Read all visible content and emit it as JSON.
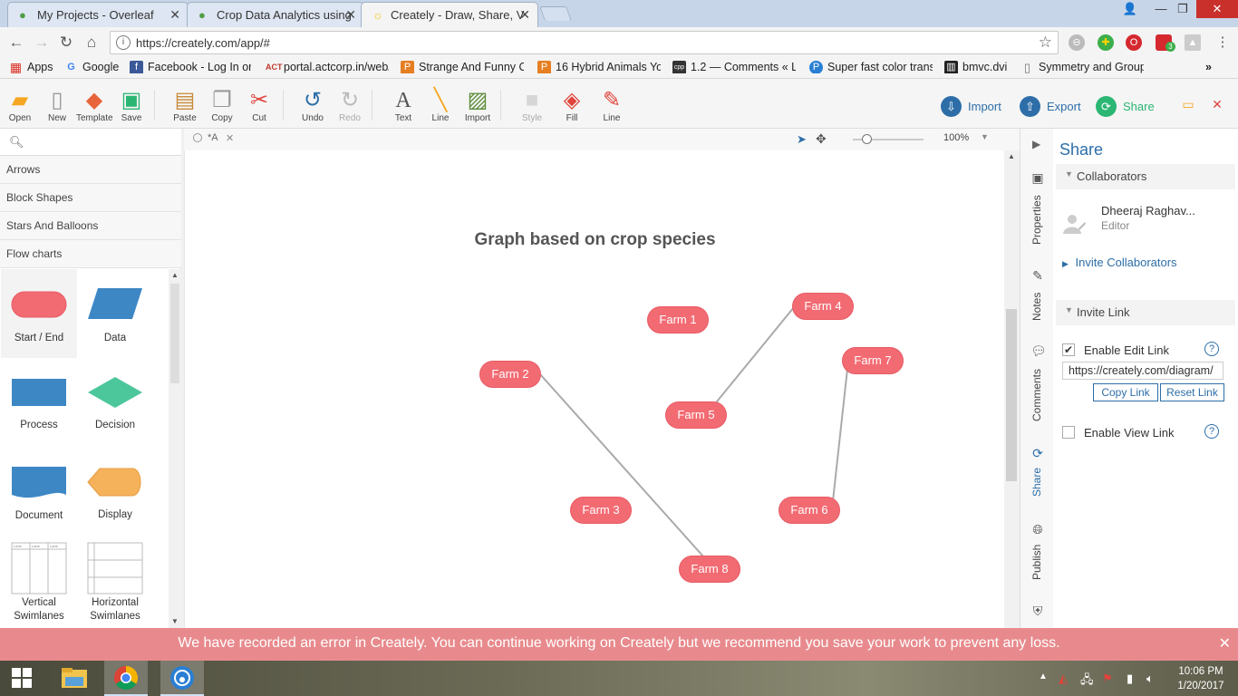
{
  "browser": {
    "tabs": [
      {
        "title": "My Projects - Overleaf",
        "icon": "overleaf-icon",
        "active": false
      },
      {
        "title": "Crop Data Analytics using",
        "icon": "overleaf-icon",
        "active": false
      },
      {
        "title": "Creately - Draw, Share, V",
        "icon": "creately-sun-icon",
        "active": true
      }
    ],
    "url": "https://creately.com/app/#",
    "extension_badge": "3"
  },
  "bookmarks": [
    {
      "label": "Apps",
      "icon": "apps-grid-icon",
      "color": "#d93025"
    },
    {
      "label": "Google",
      "icon": "google-icon",
      "color": "#4285f4"
    },
    {
      "label": "Facebook - Log In or",
      "icon": "facebook-icon",
      "color": "#3b5998"
    },
    {
      "label": "portal.actcorp.in/web/",
      "icon": "act-icon",
      "color": "#c0392b"
    },
    {
      "label": "Strange And Funny C",
      "icon": "p-icon",
      "color": "#e67e22"
    },
    {
      "label": "16 Hybrid Animals Yo",
      "icon": "p-icon",
      "color": "#e67e22"
    },
    {
      "label": "1.2 — Comments « Le",
      "icon": "cpp-icon",
      "color": "#333333"
    },
    {
      "label": "Super fast color transf",
      "icon": "p-icon",
      "color": "#2a7fd4"
    },
    {
      "label": "bmvc.dvi",
      "icon": "building-icon",
      "color": "#222222"
    },
    {
      "label": "Symmetry and Group",
      "icon": "document-icon",
      "color": "#777777"
    }
  ],
  "toolbar": {
    "tools": [
      {
        "label": "Open",
        "icon": "folder-icon",
        "glyph": "▰",
        "color": "#f5a623"
      },
      {
        "label": "New",
        "icon": "new-file-icon",
        "glyph": "▯",
        "color": "#888888"
      },
      {
        "label": "Template",
        "icon": "template-icon",
        "glyph": "◆",
        "color": "#e8643c"
      },
      {
        "label": "Save",
        "icon": "save-icon",
        "glyph": "▣",
        "color": "#2bb673"
      },
      {
        "label": "Paste",
        "icon": "paste-icon",
        "glyph": "▤",
        "color": "#c98a3a"
      },
      {
        "label": "Copy",
        "icon": "copy-icon",
        "glyph": "❐",
        "color": "#999999"
      },
      {
        "label": "Cut",
        "icon": "scissors-icon",
        "glyph": "✂",
        "color": "#e0443c"
      },
      {
        "label": "Undo",
        "icon": "undo-icon",
        "glyph": "↺",
        "color": "#2d6ea8"
      },
      {
        "label": "Redo",
        "icon": "redo-icon",
        "glyph": "↻",
        "color": "#bbbbbb"
      },
      {
        "label": "Text",
        "icon": "text-icon",
        "glyph": "A",
        "color": "#555555"
      },
      {
        "label": "Line",
        "icon": "line-icon",
        "glyph": "╱",
        "color": "#f5a623"
      },
      {
        "label": "Import",
        "icon": "image-icon",
        "glyph": "▨",
        "color": "#5b8c3a"
      },
      {
        "label": "Style",
        "icon": "style-icon",
        "glyph": "■",
        "color": "#cccccc"
      },
      {
        "label": "Fill",
        "icon": "fill-bucket-icon",
        "glyph": "◈",
        "color": "#e0443c"
      },
      {
        "label": "Line",
        "icon": "line-color-icon",
        "glyph": "✎",
        "color": "#e0443c"
      }
    ],
    "buttons": {
      "import": "Import",
      "export": "Export",
      "share": "Share"
    }
  },
  "library": {
    "search_placeholder": "",
    "categories": [
      "Arrows",
      "Block Shapes",
      "Stars And Balloons",
      "Flow charts"
    ],
    "shapes": [
      {
        "label": "Start / End",
        "icon": "start-end-shape",
        "color": "#f26b73"
      },
      {
        "label": "Data",
        "icon": "data-shape",
        "color": "#3d87c5"
      },
      {
        "label": "Process",
        "icon": "process-shape",
        "color": "#3d87c5"
      },
      {
        "label": "Decision",
        "icon": "decision-shape",
        "color": "#4cc79b"
      },
      {
        "label": "Document",
        "icon": "document-shape",
        "color": "#3d87c5"
      },
      {
        "label": "Display",
        "icon": "display-shape",
        "color": "#f5b25a"
      },
      {
        "label": "Vertical\nSwimlanes",
        "line1": "Vertical",
        "line2": "Swimlanes",
        "icon": "vertical-swimlanes-shape"
      },
      {
        "label": "Horizontal\nSwimlanes",
        "line1": "Horizontal",
        "line2": "Swimlanes",
        "icon": "horizontal-swimlanes-shape"
      }
    ],
    "swimlane_label": "Lane"
  },
  "canvas": {
    "doc_tab": "*A",
    "zoom": "100%",
    "title": "Graph based on crop species",
    "nodes": [
      "Farm 1",
      "Farm 2",
      "Farm 3",
      "Farm 4",
      "Farm 5",
      "Farm 6",
      "Farm 7",
      "Farm 8"
    ],
    "edges": [
      [
        "Farm 5",
        "Farm 4"
      ],
      [
        "Farm 2",
        "Farm 8"
      ],
      [
        "Farm 6",
        "Farm 7"
      ]
    ],
    "node_color": "#f26b73",
    "edge_color": "#aaaaaa"
  },
  "right_tabs": [
    "Properties",
    "Notes",
    "Comments",
    "Share",
    "Publish"
  ],
  "share_panel": {
    "title": "Share",
    "collaborators_header": "Collaborators",
    "collaborator_name": "Dheeraj Raghav...",
    "collaborator_role": "Editor",
    "invite_collaborators": "Invite Collaborators",
    "invite_link_header": "Invite Link",
    "enable_edit_link": "Enable Edit Link",
    "edit_link_enabled": true,
    "link_url": "https://creately.com/diagram/",
    "copy_link": "Copy Link",
    "reset_link": "Reset Link",
    "enable_view_link": "Enable View Link",
    "view_link_enabled": false
  },
  "error_banner": "We have recorded an error in Creately. You can continue working on Creately but we recommend you save your work to prevent any loss.",
  "taskbar": {
    "time": "10:06 PM",
    "date": "1/20/2017"
  },
  "colors": {
    "accent": "#2d6ea8",
    "export_share_green": "#2bb673"
  }
}
